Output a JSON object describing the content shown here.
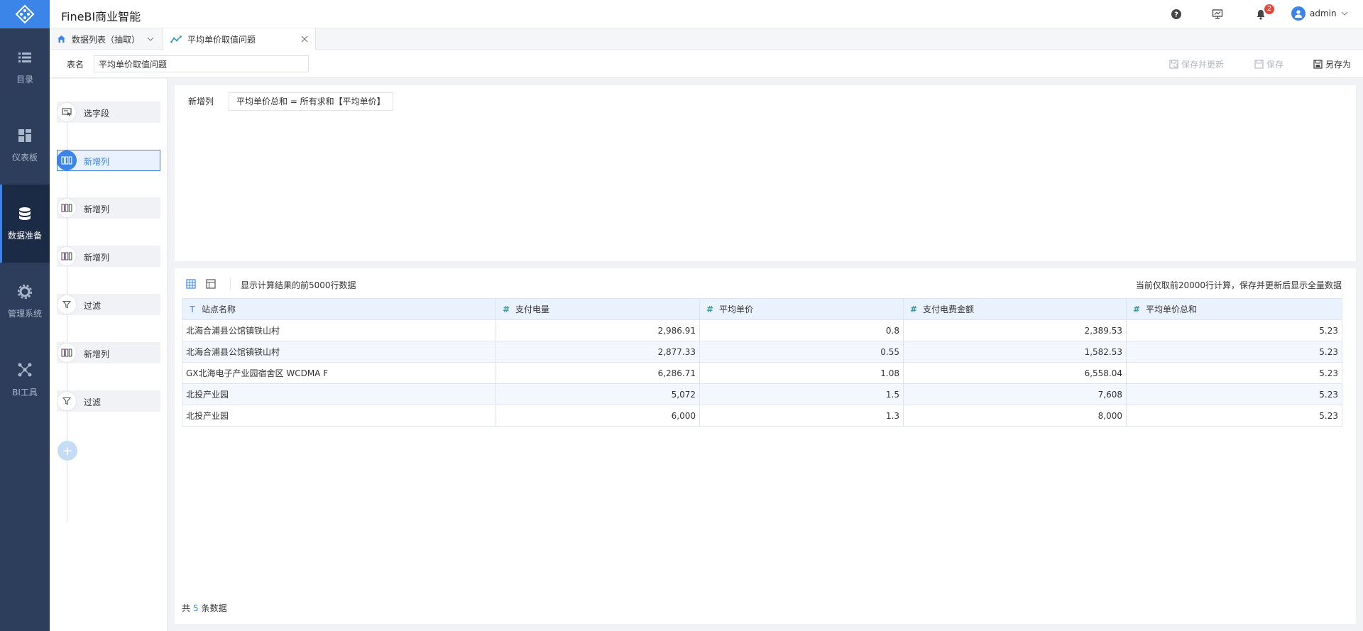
{
  "nav": {
    "items": [
      {
        "label": "目录",
        "icon": "list-icon"
      },
      {
        "label": "仪表板",
        "icon": "dashboard-icon"
      },
      {
        "label": "数据准备",
        "icon": "database-icon"
      },
      {
        "label": "管理系统",
        "icon": "gear-icon"
      },
      {
        "label": "BI工具",
        "icon": "network-icon"
      }
    ]
  },
  "header": {
    "title": "FineBI商业智能",
    "notification_count": "2",
    "user": "admin"
  },
  "tabs": [
    {
      "label": "数据列表（抽取）"
    },
    {
      "label": "平均单价取值问题"
    }
  ],
  "table_name": {
    "label": "表名",
    "value": "平均单价取值问题"
  },
  "actions": {
    "save_update": "保存并更新",
    "save": "保存",
    "save_as": "另存为"
  },
  "steps": [
    {
      "label": "选字段"
    },
    {
      "label": "新增列"
    },
    {
      "label": "新增列"
    },
    {
      "label": "新增列"
    },
    {
      "label": "过滤"
    },
    {
      "label": "新增列"
    },
    {
      "label": "过滤"
    }
  ],
  "add_step": "+",
  "config": {
    "label": "新增列",
    "formula": "平均单价总和 = 所有求和【平均单价】"
  },
  "data": {
    "info": "显示计算结果的前5000行数据",
    "note": "当前仅取前20000行计算，保存并更新后显示全量数据",
    "columns": [
      {
        "type": "T",
        "name": "站点名称"
      },
      {
        "type": "#",
        "name": "支付电量"
      },
      {
        "type": "#",
        "name": "平均单价"
      },
      {
        "type": "#",
        "name": "支付电费金额"
      },
      {
        "type": "#",
        "name": "平均单价总和"
      }
    ],
    "rows": [
      [
        "北海合浦县公馆镇铁山村",
        "2,986.91",
        "0.8",
        "2,389.53",
        "5.23"
      ],
      [
        "北海合浦县公馆镇铁山村",
        "2,877.33",
        "0.55",
        "1,582.53",
        "5.23"
      ],
      [
        "GX北海电子产业园宿舍区 WCDMA F",
        "6,286.71",
        "1.08",
        "6,558.04",
        "5.23"
      ],
      [
        "北投产业园",
        "5,072",
        "1.5",
        "7,608",
        "5.23"
      ],
      [
        "北投产业园",
        "6,000",
        "1.3",
        "8,000",
        "5.23"
      ]
    ],
    "footer_prefix": "共",
    "footer_count": "5",
    "footer_suffix": "条数据"
  }
}
